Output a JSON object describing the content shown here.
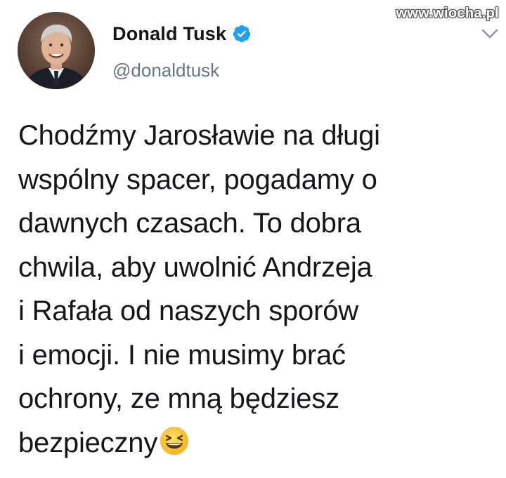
{
  "watermark": "www.wiocha.pl",
  "author": {
    "display_name": "Donald Tusk",
    "handle": "@donaldtusk",
    "verified": true,
    "avatar_icon": "profile-photo"
  },
  "tweet": {
    "lines": [
      "Chodźmy Jarosławie na długi",
      "wspólny spacer, pogadamy o",
      "dawnych czasach. To dobra",
      "chwila, aby uwolnić Andrzeja",
      "i Rafała od naszych sporów",
      "i emocji. I nie musimy brać",
      "ochrony, ze mną będziesz",
      "bezpieczny"
    ],
    "emoji": "grinning-squinting-face"
  },
  "icons": {
    "verified": "verified-badge-icon",
    "menu": "chevron-down-icon"
  },
  "colors": {
    "verified_blue": "#1da1f2",
    "handle_gray": "#657786",
    "text": "#14171a"
  }
}
